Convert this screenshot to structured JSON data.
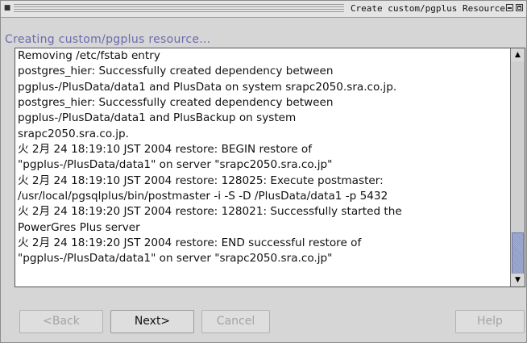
{
  "window": {
    "title": "Create custom/pgplus Resource",
    "menu_icon": "window-menu-icon",
    "minimize_icon": "minimize-icon",
    "maximize_icon": "maximize-icon"
  },
  "heading": "Creating custom/pgplus resource...",
  "log": {
    "lines": [
      "Removing /etc/fstab entry",
      "postgres_hier: Successfully created dependency between",
      "pgplus-/PlusData/data1 and PlusData on system srapc2050.sra.co.jp.",
      "postgres_hier: Successfully created dependency between",
      "pgplus-/PlusData/data1 and PlusBackup on system",
      "srapc2050.sra.co.jp.",
      "火 2月 24 18:19:10 JST 2004 restore: BEGIN restore of",
      "\"pgplus-/PlusData/data1\" on server \"srapc2050.sra.co.jp\"",
      "火 2月 24 18:19:10 JST 2004 restore: 128025: Execute postmaster:",
      "/usr/local/pgsqlplus/bin/postmaster -i -S -D /PlusData/data1 -p 5432",
      "火 2月 24 18:19:20 JST 2004 restore: 128021: Successfully started the",
      "PowerGres Plus server",
      "火 2月 24 18:19:20 JST 2004 restore: END successful restore of",
      "\"pgplus-/PlusData/data1\" on server \"srapc2050.sra.co.jp\""
    ],
    "scroll_up_icon": "scroll-up-arrow-icon",
    "scroll_down_icon": "scroll-down-arrow-icon"
  },
  "buttons": {
    "back": "<Back",
    "next": "Next>",
    "cancel": "Cancel",
    "help": "Help"
  }
}
